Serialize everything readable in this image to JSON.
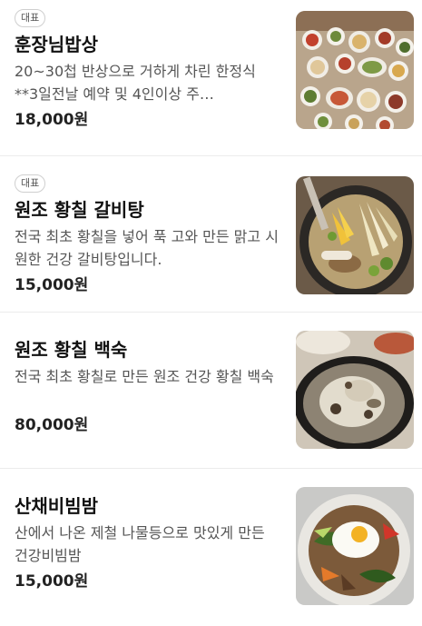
{
  "menu": {
    "items": [
      {
        "badge": "대표",
        "name": "훈장님밥상",
        "description": "20~30첩 반상으로 거하게 차린 한정식 **3일전날 예약 및 4인이상 주…",
        "price": "18,000원",
        "image_icon": "korean-table-set-photo"
      },
      {
        "badge": "대표",
        "name": "원조 황칠 갈비탕",
        "description": "전국 최초 황칠을 넣어 푹 고와 만든 맑고 시원한 건강 갈비탕입니다.",
        "price": "15,000원",
        "image_icon": "galbitang-photo"
      },
      {
        "badge": "",
        "name": "원조 황칠 백숙",
        "description": "전국 최초 황칠로 만든 원조 건강 황칠 백숙",
        "price": "80,000원",
        "image_icon": "baeksuk-photo"
      },
      {
        "badge": "",
        "name": "산채비빔밤",
        "description": "산에서 나온 제철 나물등으로 맛있게 만든 건강비빔밤",
        "price": "15,000원",
        "image_icon": "bibimbap-photo"
      }
    ]
  }
}
